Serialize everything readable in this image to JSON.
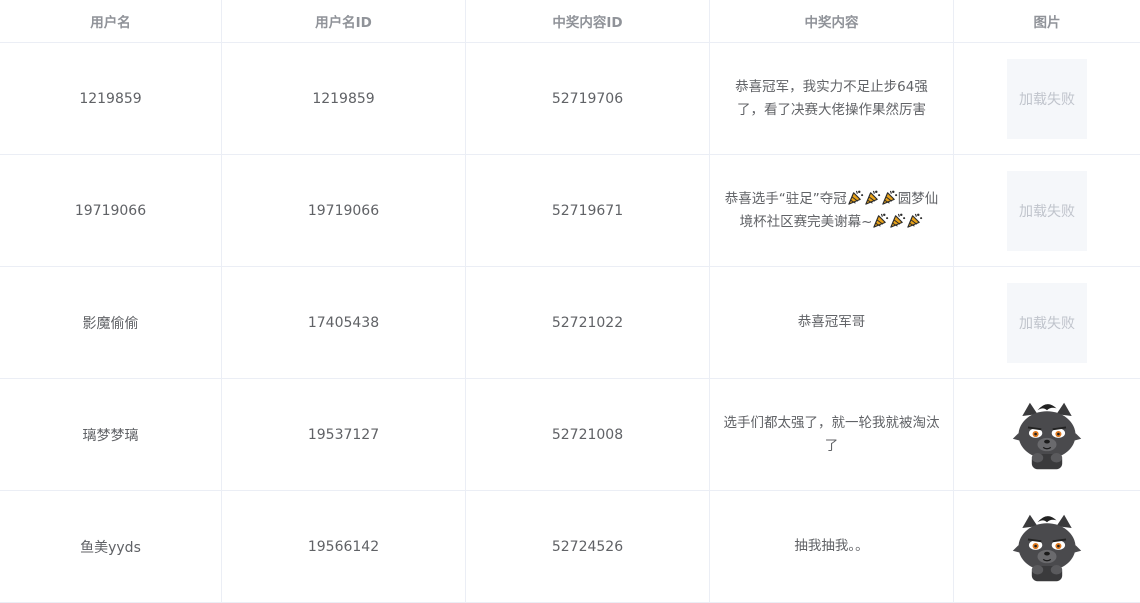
{
  "headers": [
    "用户名",
    "用户名ID",
    "中奖内容ID",
    "中奖内容",
    "图片"
  ],
  "rows": [
    {
      "username": "1219859",
      "user_id": "1219859",
      "content_id": "52719706",
      "content": "恭喜冠军，我实力不足止步64强了，看了决赛大佬操作果然厉害",
      "image": "加载失败"
    },
    {
      "username": "19719066",
      "user_id": "19719066",
      "content_id": "52719671",
      "content_pre": "恭喜选手“驻足”夺冠",
      "content_mid": "圆梦仙境杯社区赛完美谢幕~",
      "content_icon": "party-popper-icon",
      "image": "加载失败"
    },
    {
      "username": "影魔偷偷",
      "user_id": "17405438",
      "content_id": "52721022",
      "content": "恭喜冠军哥",
      "image": "加载失败"
    },
    {
      "username": "璃梦梦璃",
      "user_id": "19537127",
      "content_id": "52721008",
      "content": "选手们都太强了，就一轮我就被淘汰了",
      "image_icon": "wolf-avatar-icon"
    },
    {
      "username": "鱼美yyds",
      "user_id": "19566142",
      "content_id": "52724526",
      "content": "抽我抽我。。",
      "image_icon": "wolf-avatar-icon"
    }
  ]
}
